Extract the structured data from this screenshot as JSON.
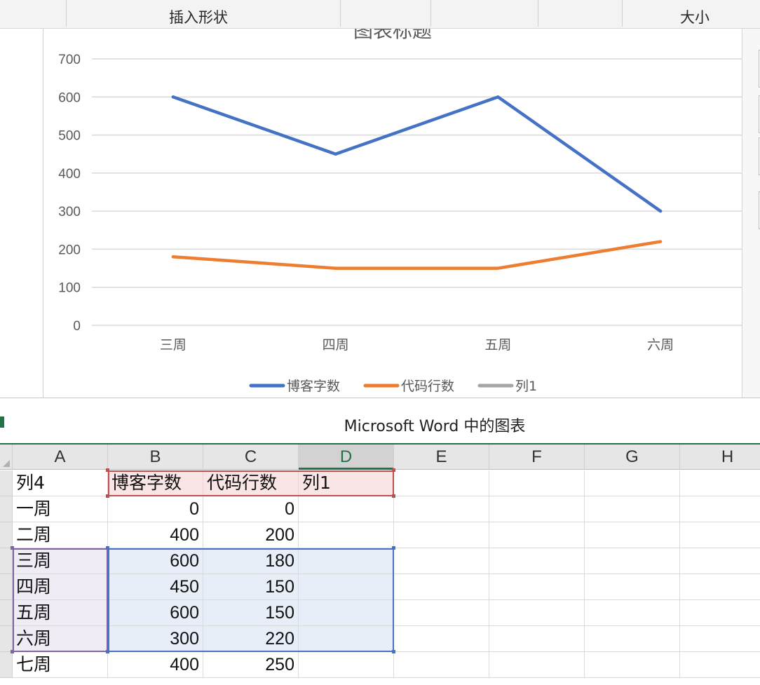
{
  "ribbon": {
    "insert_shape": "插入形状",
    "size": "大小"
  },
  "chart_data": {
    "type": "line",
    "title": "图表标题",
    "categories": [
      "三周",
      "四周",
      "五周",
      "六周"
    ],
    "series": [
      {
        "name": "博客字数",
        "values": [
          600,
          450,
          600,
          300
        ],
        "color": "#4472C4"
      },
      {
        "name": "代码行数",
        "values": [
          180,
          150,
          150,
          220
        ],
        "color": "#ED7D31"
      },
      {
        "name": "列1",
        "values": [
          null,
          null,
          null,
          null
        ],
        "color": "#A5A5A5"
      }
    ],
    "ylim": [
      0,
      700
    ],
    "yticks": [
      0,
      100,
      200,
      300,
      400,
      500,
      600,
      700
    ],
    "grid": true,
    "legend": "bottom"
  },
  "window": {
    "title": "Microsoft Word 中的图表"
  },
  "sheet": {
    "columns": [
      "A",
      "B",
      "C",
      "D",
      "E",
      "F",
      "G",
      "H"
    ],
    "selected_column": "D",
    "rows": [
      [
        "列4",
        "博客字数",
        "代码行数",
        "列1"
      ],
      [
        "一周",
        "0",
        "0",
        ""
      ],
      [
        "二周",
        "400",
        "200",
        ""
      ],
      [
        "三周",
        "600",
        "180",
        ""
      ],
      [
        "四周",
        "450",
        "150",
        ""
      ],
      [
        "五周",
        "600",
        "150",
        ""
      ],
      [
        "六周",
        "300",
        "220",
        ""
      ],
      [
        "七周",
        "400",
        "250",
        ""
      ]
    ]
  }
}
